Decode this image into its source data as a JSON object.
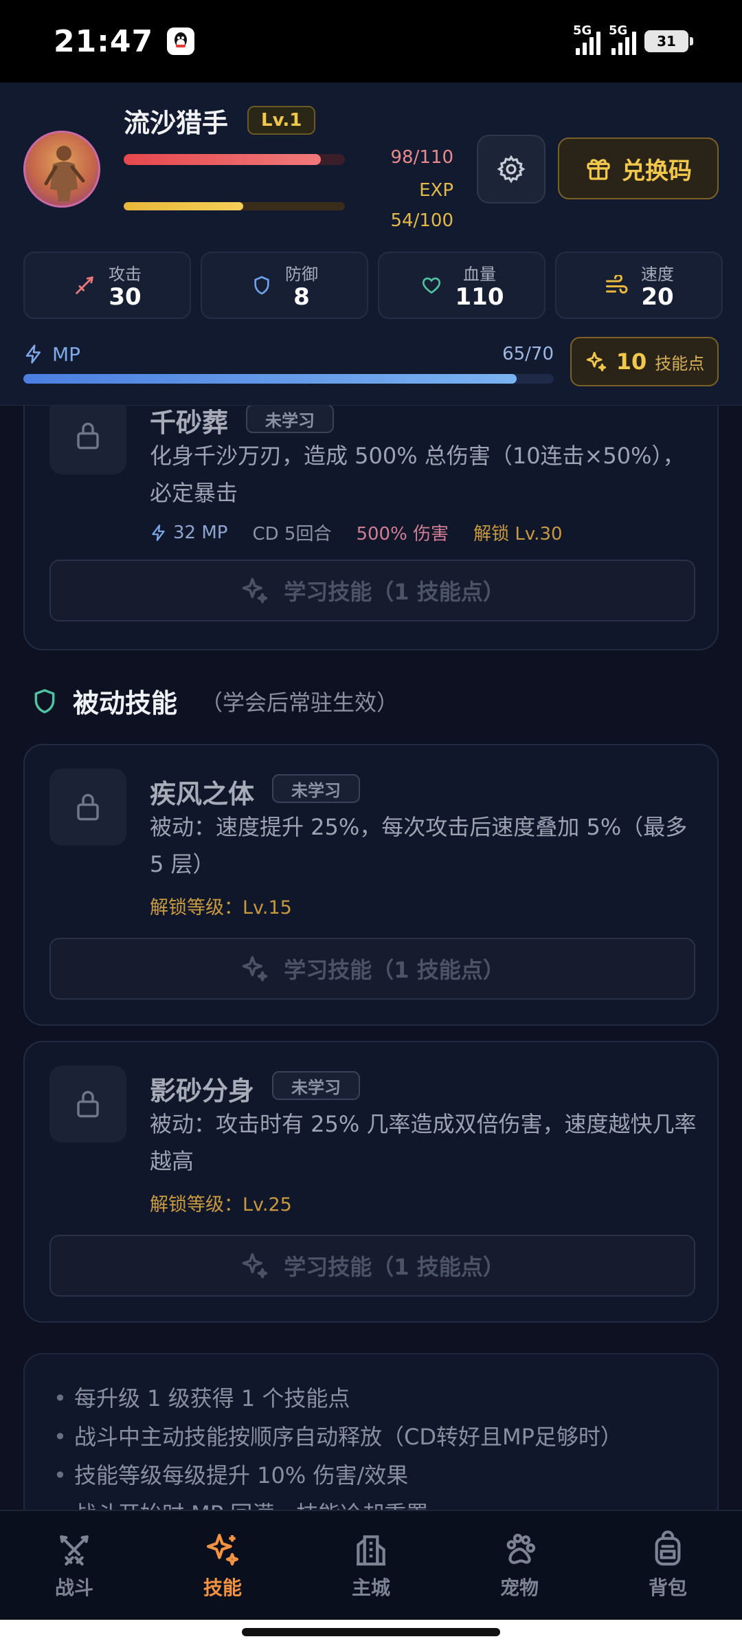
{
  "status_bar": {
    "time": "21:47",
    "network1": "5G",
    "network2": "5G",
    "battery": "31"
  },
  "player": {
    "name": "流沙猎手",
    "level": "Lv.1",
    "hp_text": "98/110",
    "hp_progress": 0.89,
    "exp_label": "EXP",
    "exp_text": "54/100",
    "exp_progress": 0.54
  },
  "header": {
    "redeem_label": "兑换码"
  },
  "stats": [
    {
      "label": "攻击",
      "value": "30",
      "icon": "sword-icon",
      "color": "#e8787a"
    },
    {
      "label": "防御",
      "value": "8",
      "icon": "shield-icon",
      "color": "#6fa0ea"
    },
    {
      "label": "血量",
      "value": "110",
      "icon": "heart-icon",
      "color": "#4fc3a1"
    },
    {
      "label": "速度",
      "value": "20",
      "icon": "wind-icon",
      "color": "#e8b83a"
    }
  ],
  "mp": {
    "label": "MP",
    "value": "65/70",
    "progress": 0.93
  },
  "skill_points": {
    "value": "10",
    "label": "技能点"
  },
  "active_skill": {
    "name": "千砂葬",
    "status": "未学习",
    "description": "化身千沙万刃，造成 500% 总伤害（10连击×50%），必定暴击",
    "mp_cost": "32 MP",
    "cooldown": "CD 5回合",
    "damage": "500% 伤害",
    "unlock": "解锁 Lv.30",
    "learn_label": "学习技能（1 技能点）"
  },
  "passive_section": {
    "title": "被动技能",
    "subtitle": "（学会后常驻生效）"
  },
  "passive_skills": [
    {
      "name": "疾风之体",
      "status": "未学习",
      "description": "被动：速度提升 25%，每次攻击后速度叠加 5%（最多 5 层）",
      "unlock": "解锁等级：Lv.15",
      "learn_label": "学习技能（1 技能点）"
    },
    {
      "name": "影砂分身",
      "status": "未学习",
      "description": "被动：攻击时有 25% 几率造成双倍伤害，速度越快几率越高",
      "unlock": "解锁等级：Lv.25",
      "learn_label": "学习技能（1 技能点）"
    }
  ],
  "tips": [
    "每升级 1 级获得 1 个技能点",
    "战斗中主动技能按顺序自动释放（CD转好且MP足够时）",
    "技能等级每级提升 10% 伤害/效果",
    "战斗开始时 MP 回满，技能冷却重置"
  ],
  "bottom_nav": [
    {
      "label": "战斗",
      "icon": "crossed-swords-icon"
    },
    {
      "label": "技能",
      "icon": "sparkles-icon",
      "active": true
    },
    {
      "label": "主城",
      "icon": "castle-icon"
    },
    {
      "label": "宠物",
      "icon": "paw-icon"
    },
    {
      "label": "背包",
      "icon": "backpack-icon"
    }
  ],
  "colors": {
    "accent": "#f39240",
    "gold": "#f2c84c",
    "background": "#0d1122"
  }
}
